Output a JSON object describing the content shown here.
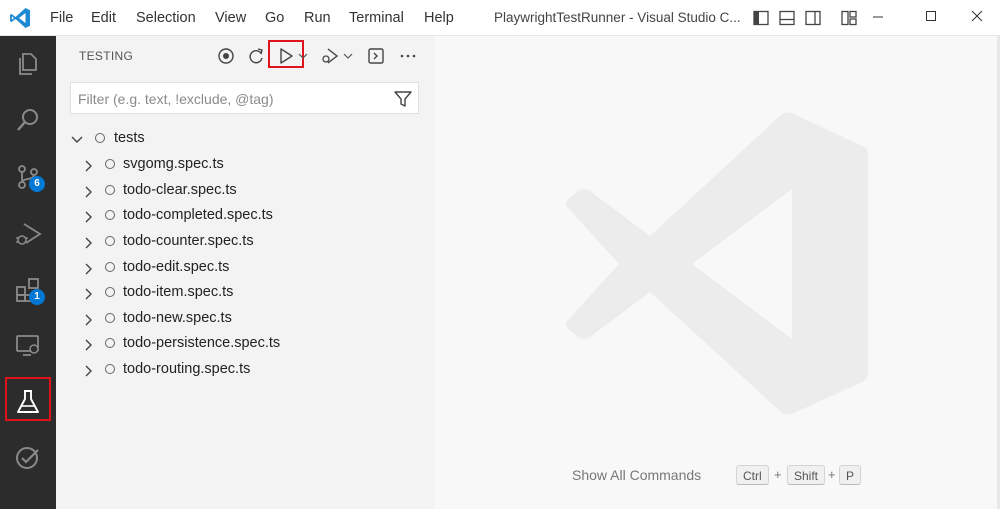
{
  "titlebar": {
    "logo_icon": "vscode-logo-icon",
    "menu": [
      "File",
      "Edit",
      "Selection",
      "View",
      "Go",
      "Run",
      "Terminal",
      "Help"
    ],
    "title": "PlaywrightTestRunner - Visual Studio C...",
    "layout_icons": [
      "toggle-primary-sidebar-icon",
      "toggle-panel-icon",
      "toggle-secondary-sidebar-icon",
      "customize-layout-icon"
    ],
    "window_controls": [
      "minimize-icon",
      "maximize-icon",
      "close-icon"
    ]
  },
  "activitybar": {
    "items": [
      {
        "name": "explorer-icon"
      },
      {
        "name": "search-icon"
      },
      {
        "name": "source-control-icon",
        "badge": "6"
      },
      {
        "name": "run-and-debug-icon"
      },
      {
        "name": "extensions-icon",
        "badge": "1"
      },
      {
        "name": "remote-explorer-icon"
      },
      {
        "name": "testing-icon",
        "active": true
      },
      {
        "name": "todo-check-icon"
      }
    ],
    "highlight_color": "#e0141c",
    "badge_color": "#0078d4"
  },
  "sidebar": {
    "title": "TESTING",
    "toolbar": [
      "refresh-tests-icon",
      "reload-icon",
      "run-tests-icon",
      "debug-tests-icon",
      "show-output-icon",
      "more-actions-icon"
    ],
    "filter": {
      "placeholder": "Filter (e.g. text, !exclude, @tag)",
      "value": ""
    },
    "tree": {
      "root": "tests",
      "items": [
        "svgomg.spec.ts",
        "todo-clear.spec.ts",
        "todo-completed.spec.ts",
        "todo-counter.spec.ts",
        "todo-edit.spec.ts",
        "todo-item.spec.ts",
        "todo-new.spec.ts",
        "todo-persistence.spec.ts",
        "todo-routing.spec.ts"
      ]
    }
  },
  "editor": {
    "watermark_icon": "vscode-watermark-icon",
    "commands": [
      {
        "label": "Show All Commands",
        "keys": [
          "Ctrl",
          "Shift",
          "P"
        ]
      }
    ]
  }
}
